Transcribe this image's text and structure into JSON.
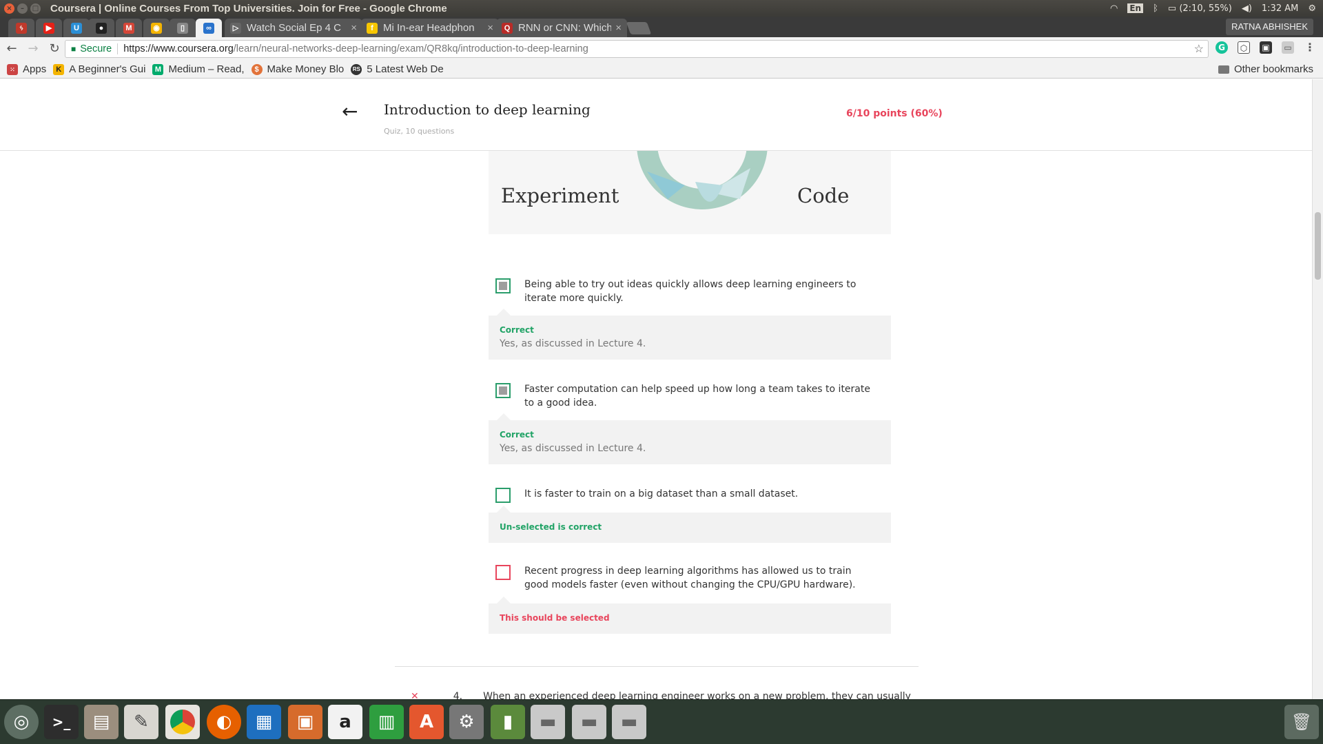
{
  "os": {
    "window_title": "Coursera | Online Courses From Top Universities. Join for Free - Google Chrome",
    "lang": "En",
    "battery": "(2:10, 55%)",
    "clock": "1:32 AM"
  },
  "browser": {
    "profile": "RATNA ABHISHEK",
    "tabs": [
      {
        "label": "Watch Social Ep 4 C"
      },
      {
        "label": "Mi In-ear Headphon"
      },
      {
        "label": "RNN or CNN: Which"
      }
    ],
    "url": {
      "secure_label": "Secure",
      "host": "https://www.coursera.org",
      "path": "/learn/neural-networks-deep-learning/exam/QR8kq/introduction-to-deep-learning"
    },
    "bookmarks": [
      {
        "label": "Apps",
        "icon": "apps-grid-icon"
      },
      {
        "label": "A Beginner's Gui",
        "icon": "k-icon"
      },
      {
        "label": "Medium – Read, ",
        "icon": "medium-icon"
      },
      {
        "label": "Make Money Blo",
        "icon": "money-icon"
      },
      {
        "label": "5 Latest Web De",
        "icon": "rs-icon"
      }
    ],
    "other_bookmarks": "Other bookmarks"
  },
  "quiz": {
    "title": "Introduction to deep learning",
    "subtitle": "Quiz, 10 questions",
    "score": "6/10 points (60%)",
    "illustration_labels": {
      "left": "Experiment",
      "right": "Code"
    },
    "options": [
      {
        "text": "Being able to try out ideas quickly allows deep learning engineers to iterate more quickly.",
        "checked": true,
        "status": "Correct",
        "detail": "Yes, as discussed in Lecture 4."
      },
      {
        "text": "Faster computation can help speed up how long a team takes to iterate to a good idea.",
        "checked": true,
        "status": "Correct",
        "detail": "Yes, as discussed in Lecture 4."
      },
      {
        "text": "It is faster to train on a big dataset than a small dataset.",
        "checked": false,
        "status": "Un-selected is correct",
        "detail": ""
      },
      {
        "text": "Recent progress in deep learning algorithms has allowed us to train good models faster (even without changing the CPU/GPU hardware).",
        "checked": false,
        "status": "This should be selected",
        "detail": ""
      }
    ],
    "next_question": {
      "number": "4.",
      "text": "When an experienced deep learning engineer works on a new problem, they can usually"
    }
  },
  "colors": {
    "correct": "#21a366",
    "incorrect": "#e8455c",
    "launcher": "#2c3a30"
  }
}
